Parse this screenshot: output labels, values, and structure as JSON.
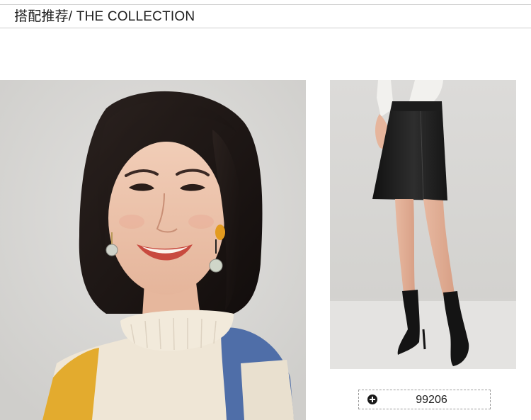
{
  "header": {
    "title": "搭配推荐/ THE COLLECTION"
  },
  "product": {
    "code": "99206"
  },
  "icons": {
    "add": "plus-circle-icon"
  },
  "colors": {
    "divider": "#cfcfcf",
    "text": "#1e1e1e",
    "sweater_cream": "#efe6d6",
    "sweater_blue": "#4f6ea8",
    "sweater_yellow": "#e3ab2e",
    "skirt_black": "#1b1b1b"
  }
}
